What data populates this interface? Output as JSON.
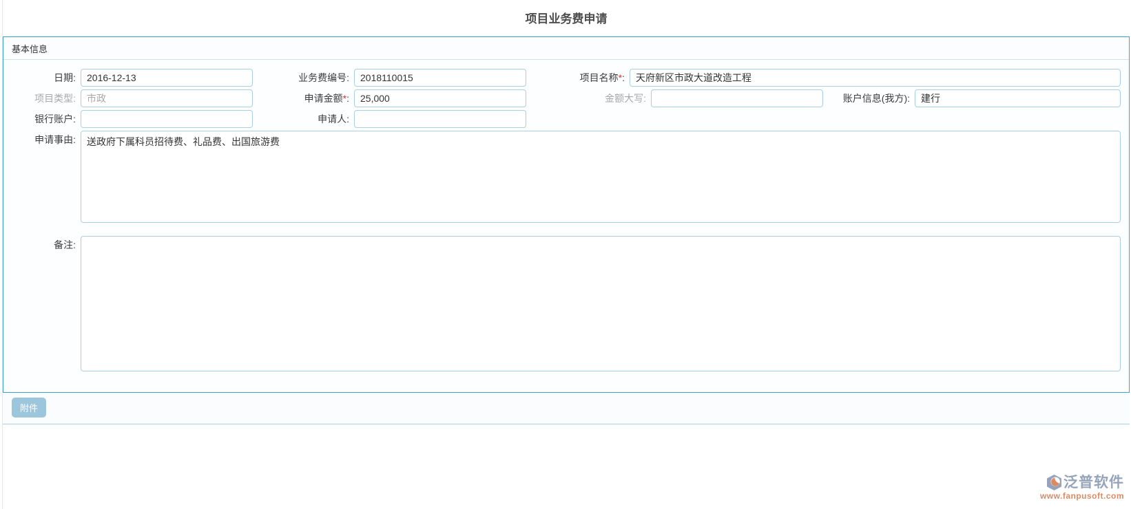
{
  "ui": {
    "colon": ":"
  },
  "page": {
    "title": "项目业务费申请"
  },
  "basic_info": {
    "section_title": "基本信息",
    "fields": {
      "date": {
        "label": "日期",
        "required": "",
        "value": "2016-12-13"
      },
      "fee_number": {
        "label": "业务费编号",
        "required": "",
        "value": "2018110015"
      },
      "project_name": {
        "label": "项目名称",
        "required": "*",
        "value": "天府新区市政大道改造工程"
      },
      "project_type": {
        "label": "项目类型",
        "required": "",
        "value": "市政"
      },
      "apply_amount": {
        "label": "申请金额",
        "required": "*",
        "value": "25,000"
      },
      "amount_in_words": {
        "label": "金额大写",
        "required": "",
        "value": ""
      },
      "account_info": {
        "label": "账户信息(我方)",
        "required": "",
        "value": "建行"
      },
      "bank_account": {
        "label": "银行账户",
        "required": "",
        "value": ""
      },
      "applicant": {
        "label": "申请人",
        "required": "",
        "value": ""
      },
      "apply_reason": {
        "label": "申请事由",
        "required": "",
        "value": "送政府下属科员招待费、礼品费、出国旅游费"
      },
      "remark": {
        "label": "备注",
        "required": "",
        "value": ""
      }
    }
  },
  "attachment": {
    "button_label": "附件"
  },
  "watermark": {
    "brand": "泛普软件",
    "url": "www.fanpusoft.com"
  },
  "colors": {
    "panel_border": "#38a3d2",
    "header_sep": "#cfe2ed",
    "input_border": "#a9cfe5",
    "attach_button_bg": "#9cc6dc",
    "brand_color": "#95a3bb",
    "url_color": "#dd8a62",
    "required_color": "#e0352b",
    "label_color": "#3c3c3c",
    "disabled_color": "#a8a8a8"
  }
}
